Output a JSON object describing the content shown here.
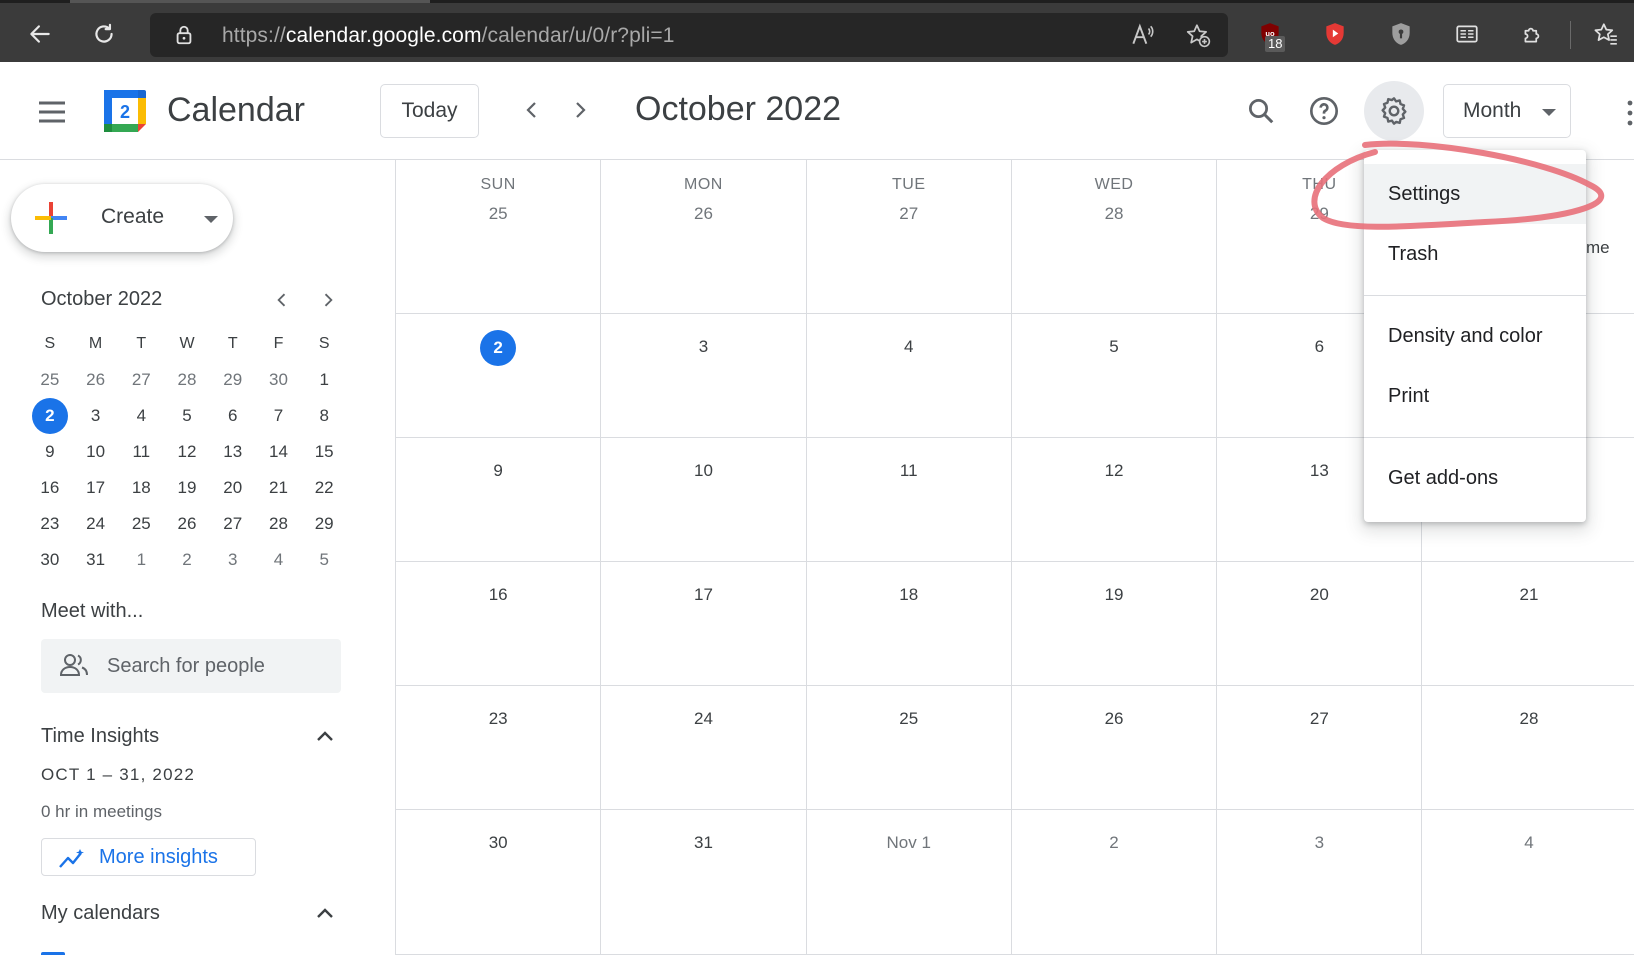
{
  "browser": {
    "url_prefix": "https://",
    "url_host": "calendar.google.com",
    "url_path": "/calendar/u/0/r?pli=1",
    "ext_badge": "18"
  },
  "header": {
    "app_title": "Calendar",
    "logo_day": "2",
    "today_label": "Today",
    "month_title": "October 2022",
    "view_label": "Month"
  },
  "sidebar": {
    "create_label": "Create",
    "mini_title": "October 2022",
    "mini_dow": [
      "S",
      "M",
      "T",
      "W",
      "T",
      "F",
      "S"
    ],
    "mini_weeks": [
      [
        "25",
        "26",
        "27",
        "28",
        "29",
        "30",
        "1"
      ],
      [
        "2",
        "3",
        "4",
        "5",
        "6",
        "7",
        "8"
      ],
      [
        "9",
        "10",
        "11",
        "12",
        "13",
        "14",
        "15"
      ],
      [
        "16",
        "17",
        "18",
        "19",
        "20",
        "21",
        "22"
      ],
      [
        "23",
        "24",
        "25",
        "26",
        "27",
        "28",
        "29"
      ],
      [
        "30",
        "31",
        "1",
        "2",
        "3",
        "4",
        "5"
      ]
    ],
    "meet_title": "Meet with...",
    "search_placeholder": "Search for people",
    "insights_title": "Time Insights",
    "insights_range": "OCT 1 – 31, 2022",
    "insights_meetings": "0 hr in meetings",
    "more_insights_label": "More insights",
    "my_calendars_title": "My calendars"
  },
  "grid": {
    "dow": [
      "SUN",
      "MON",
      "TUE",
      "WED",
      "THU"
    ],
    "weeks": [
      [
        "25",
        "26",
        "27",
        "28",
        "29",
        ""
      ],
      [
        "2",
        "3",
        "4",
        "5",
        "6",
        ""
      ],
      [
        "9",
        "10",
        "11",
        "12",
        "13",
        ""
      ],
      [
        "16",
        "17",
        "18",
        "19",
        "20",
        "21"
      ],
      [
        "23",
        "24",
        "25",
        "26",
        "27",
        "28"
      ],
      [
        "30",
        "31",
        "Nov 1",
        "2",
        "3",
        "4"
      ]
    ]
  },
  "menu": {
    "items": [
      "Settings",
      "Trash",
      "Density and color",
      "Print",
      "Get add-ons"
    ]
  },
  "peek_text": "me",
  "colors": {
    "accent": "#1a73e8",
    "annotation": "#e8707a"
  }
}
